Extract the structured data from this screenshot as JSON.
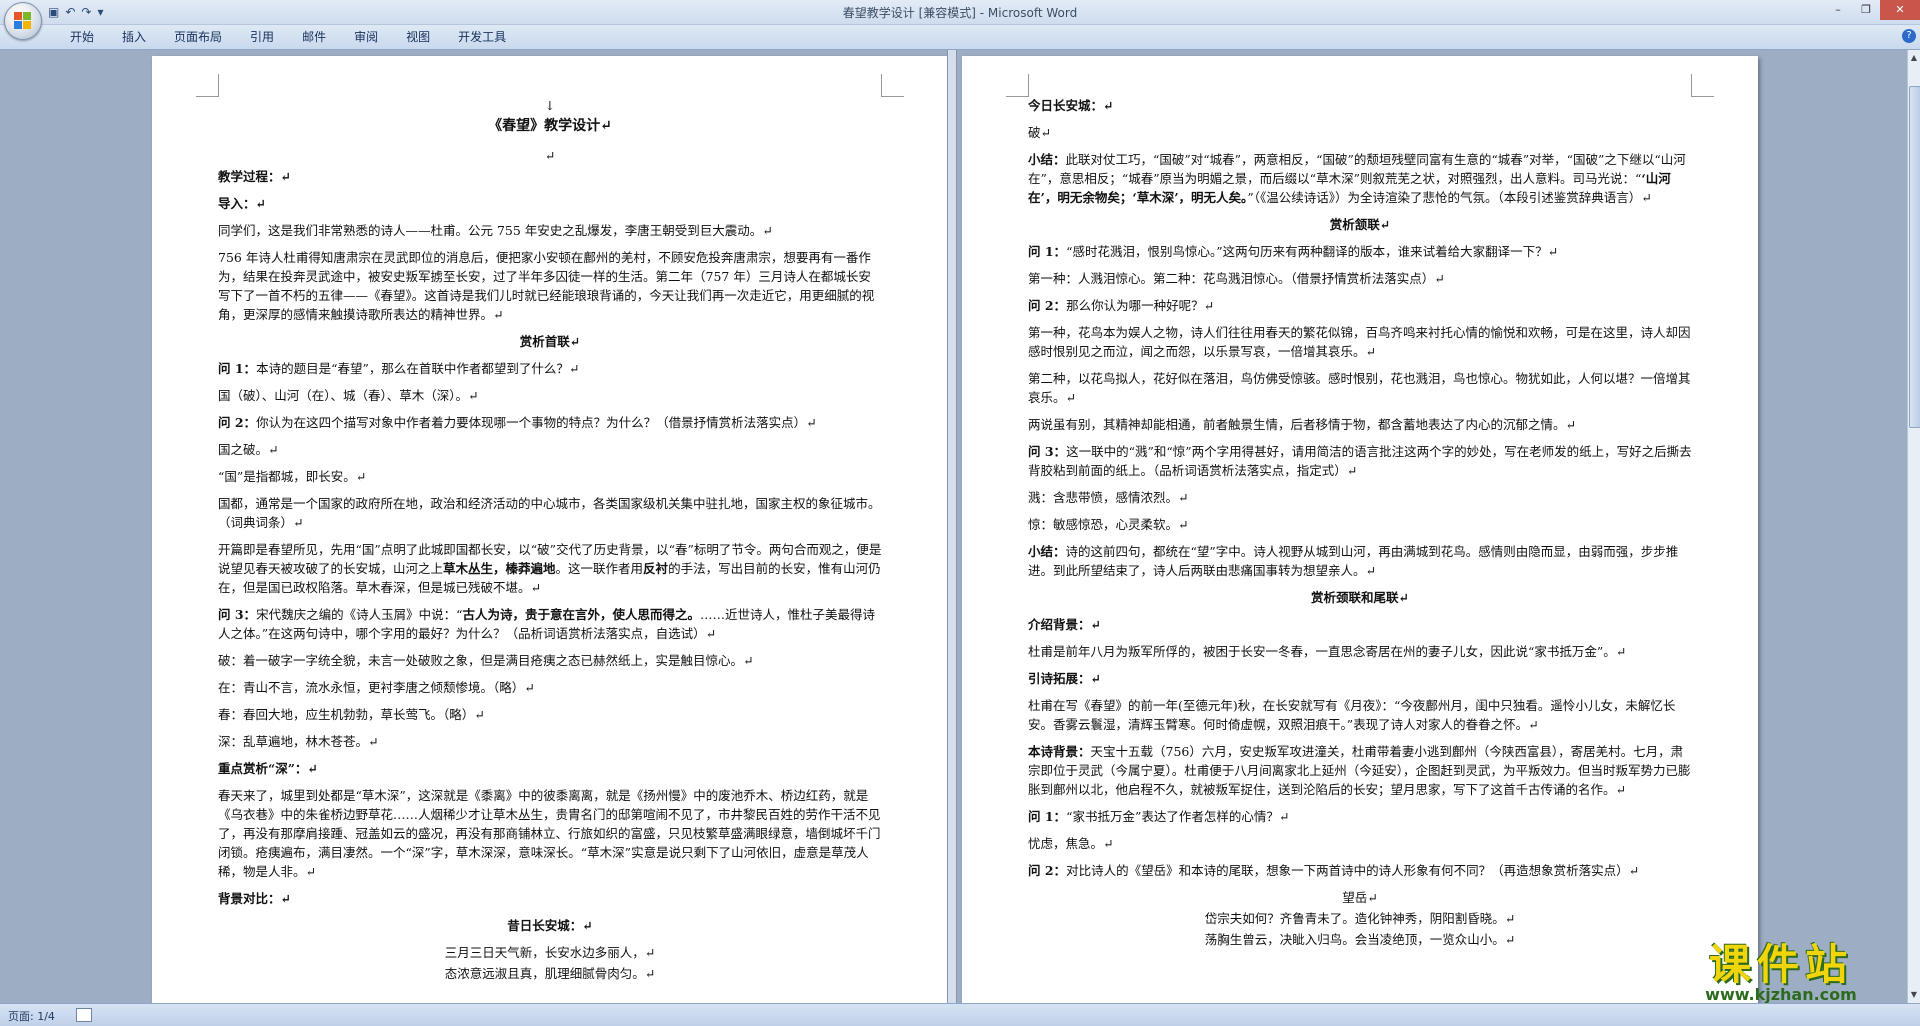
{
  "app": {
    "title": "春望教学设计 [兼容模式] - Microsoft Word",
    "help_label": "?",
    "qat": [
      "▣",
      "↶",
      "↷",
      "▾"
    ],
    "window_buttons": [
      "–",
      "❐",
      "✕"
    ]
  },
  "ribbon": {
    "tabs": [
      "开始",
      "插入",
      "页面布局",
      "引用",
      "邮件",
      "审阅",
      "视图",
      "开发工具"
    ]
  },
  "status": {
    "page_label": "页面: 1/4"
  },
  "watermark": {
    "main": "课件站",
    "url": "www.kjzhan.com"
  },
  "left_page": {
    "mark": "↓",
    "title": "《春望》教学设计↵",
    "blank": "↵",
    "p_process": "教学过程：↵",
    "p_intro": "导入：↵",
    "p1": "同学们，这是我们非常熟悉的诗人——杜甫。公元 755 年安史之乱爆发，李唐王朝受到巨大震动。↵",
    "p2": "756 年诗人杜甫得知唐肃宗在灵武即位的消息后，便把家小安顿在鄜州的羌村，不顾安危投奔唐肃宗，想要再有一番作为，结果在投奔灵武途中，被安史叛军掳至长安，过了半年多囚徒一样的生活。第二年（757 年）三月诗人在都城长安写下了一首不朽的五律——《春望》。这首诗是我们儿时就已经能琅琅背诵的，今天让我们再一次走近它，用更细腻的视角，更深厚的感情来触摸诗歌所表达的精神世界。↵",
    "h1": "赏析首联↵",
    "q1_label": "问 1：",
    "q1_text": "本诗的题目是“春望”，那么在首联中作者都望到了什么？↵",
    "a1": "国（破）、山河（在）、城（春）、草木（深）。↵",
    "q2_label": "问 2：",
    "q2_text": "你认为在这四个描写对象中作者着力要体现哪一个事物的特点？为什么？（借景抒情赏析法落实点）↵",
    "a2": "国之破。↵",
    "a3": "“国”是指都城，即长安。↵",
    "a4": "国都，通常是一个国家的政府所在地，政治和经济活动的中心城市，各类国家级机关集中驻扎地，国家主权的象征城市。（词典词条）↵",
    "a5_pre": "开篇即是春望所见，先用“国”点明了此城即国都长安，以“破”交代了历史背景，以“春”标明了节令。两句合而观之，便是说望见春天被攻破了的长安城，山河之上",
    "a5_bold": "草木丛生，榛莽遍地",
    "a5_mid": "。这一联作者用",
    "a5_bold2": "反衬",
    "a5_post": "的手法，写出目前的长安，惟有山河仍在，但是国已政权陷落。草木春深，但是城已残破不堪。↵",
    "q3_label": "问 3：",
    "q3_pre": "宋代魏庆之编的《诗人玉屑》中说：“",
    "q3_bold": "古人为诗，贵于意在言外，使人思而得之。",
    "q3_post": "……近世诗人，惟杜子美最得诗人之体。”在这两句诗中，哪个字用的最好？为什么？（品析词语赏析法落实点，自选试）↵",
    "a6": "破：着一破字一字统全貌，未言一处破败之象，但是满目疮痍之态已赫然纸上，实是触目惊心。↵",
    "a7": "在：青山不言，流水永恒，更衬李唐之倾颓惨境。（略）↵",
    "a8": "春：春回大地，应生机勃勃，草长莺飞。（略）↵",
    "a9": "深：乱草遍地，林木苍苍。↵",
    "focus": "重点赏析“深”：↵",
    "a10": "春天来了，城里到处都是“草木深”，这深就是《黍离》中的彼黍离离，就是《扬州慢》中的废池乔木、桥边红药，就是《乌衣巷》中的朱雀桥边野草花……人烟稀少才让草木丛生，贵胄名门的邸第喧闹不见了，市井黎民百姓的劳作干活不见了，再没有那摩肩接踵、冠盖如云的盛况，再没有那商铺林立、行旅如织的富盛，只见枝繁草盛满眼绿意，墙倒城坏千门闭锁。疮痍遍布，满目凄然。一个“深”字，草木深深，意味深长。“草木深”实意是说只剩下了山河依旧，虚意是草茂人稀，物是人非。↵",
    "bg_compare": "背景对比：↵",
    "old_city": "昔日长安城：↵",
    "poem1": "三月三日天气新，长安水边多丽人，↵",
    "poem2": "态浓意远淑且真，肌理细腻骨肉匀。↵"
  },
  "right_page": {
    "today_city": "今日长安城：↵",
    "po": "破↵",
    "sum1_label": "小结：",
    "sum1_pre": "此联对仗工巧，“国破”对“城春”，两意相反，“国破”的颓垣残壁同富有生意的“城春”对举，“国破”之下继以“山河在”，意思相反；“城春”原当为明媚之景，而后缀以“草木深”则叙荒芜之状，对照强烈，出人意料。司马光说：“",
    "sum1_bold": "‘山河在’，明无余物矣；‘草木深’，明无人矣。",
    "sum1_post": "”（《温公续诗话》）为全诗渲染了悲怆的气氛。（本段引述鉴赏辞典语言）↵",
    "h2": "赏析颔联↵",
    "rq1_label": "问 1：",
    "rq1_text": "“感时花溅泪，恨别鸟惊心。”这两句历来有两种翻译的版本，谁来试着给大家翻译一下？↵",
    "r1": "第一种：人溅泪惊心。第二种：花鸟溅泪惊心。（借景抒情赏析法落实点）↵",
    "rq2_label": "问 2：",
    "rq2_text": "那么你认为哪一种好呢？↵",
    "r2": "第一种，花鸟本为娱人之物，诗人们往往用春天的繁花似锦，百鸟齐鸣来衬托心情的愉悦和欢畅，可是在这里，诗人却因感时恨别见之而泣，闻之而怨，以乐景写哀，一倍增其哀乐。↵",
    "r3": "第二种，以花鸟拟人，花好似在落泪，鸟仿佛受惊骇。感时恨别，花也溅泪，鸟也惊心。物犹如此，人何以堪？一倍增其哀乐。↵",
    "r4": "两说虽有别，其精神却能相通，前者触景生情，后者移情于物，都含蓄地表达了内心的沉郁之情。↵",
    "rq3_label": "问 3：",
    "rq3_text": "这一联中的“溅”和“惊”两个字用得甚好，请用简洁的语言批注这两个字的妙处，写在老师发的纸上，写好之后撕去背胶粘到前面的纸上。（品析词语赏析法落实点，指定式）↵",
    "r5": "溅：含悲带愤，感情浓烈。↵",
    "r6": "惊：敏感惊恐，心灵柔软。↵",
    "sum2_label": "小结：",
    "sum2_text": "诗的这前四句，都统在“望”字中。诗人视野从城到山河，再由满城到花鸟。感情则由隐而显，由弱而强，步步推进。到此所望结束了，诗人后两联由悲痛国事转为想望亲人。↵",
    "h3": "赏析颈联和尾联↵",
    "intro_bg": "介绍背景：↵",
    "r7": "杜甫是前年八月为叛军所俘的，被困于长安一冬春，一直思念寄居在州的妻子儿女，因此说“家书抵万金”。↵",
    "expand": "引诗拓展：↵",
    "r8": "杜甫在写《春望》的前一年(至德元年)秋，在长安就写有《月夜》：“今夜鄜州月，闺中只独看。遥怜小儿女，未解忆长安。香雾云鬟湿，清辉玉臂寒。何时倚虚幌，双照泪痕干。”表现了诗人对家人的眷眷之怀。↵",
    "bg_label": "本诗背景：",
    "bg_text": "天宝十五载（756）六月，安史叛军攻进潼关，杜甫带着妻小逃到鄜州（今陕西富县），寄居羌村。七月，肃宗即位于灵武（今属宁夏）。杜甫便于八月间离家北上延州（今延安），企图赶到灵武，为平叛效力。但当时叛军势力已膨胀到鄜州以北，他启程不久，就被叛军捉住，送到沦陷后的长安；望月思家，写下了这首千古传诵的名作。↵",
    "rq4_label": "问 1：",
    "rq4_text": "“家书抵万金”表达了作者怎样的心情？↵",
    "r9": "忧虑，焦急。↵",
    "rq5_label": "问 2：",
    "rq5_text": "对比诗人的《望岳》和本诗的尾联，想象一下两首诗中的诗人形象有何不同？（再造想象赏析落实点）↵",
    "wangyue": "望岳↵",
    "poem3": "岱宗夫如何？齐鲁青未了。造化钟神秀，阴阳割昏晓。↵",
    "poem4": "荡胸生曾云，决眦入归鸟。会当凌绝顶，一览众山小。↵"
  }
}
